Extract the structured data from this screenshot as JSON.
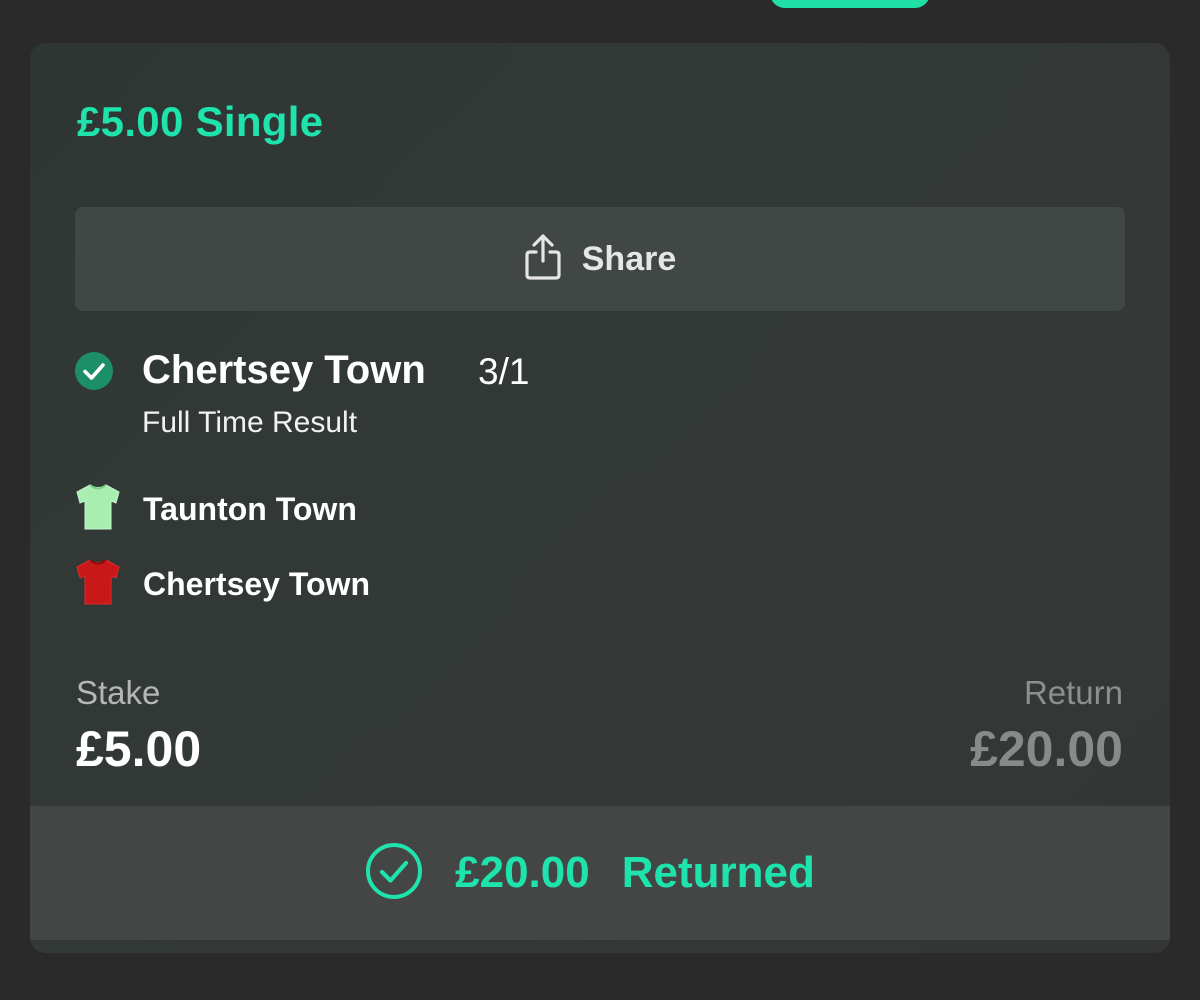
{
  "bet": {
    "title": "£5.00 Single",
    "share_label": "Share",
    "selection": {
      "name": "Chertsey Town",
      "odds": "3/1",
      "market": "Full Time Result",
      "status": "won"
    },
    "teams": [
      {
        "name": "Taunton Town",
        "shirt_color": "#a8eeb0"
      },
      {
        "name": "Chertsey Town",
        "shirt_color": "#c81818"
      }
    ],
    "stake_label": "Stake",
    "stake_value": "£5.00",
    "return_label": "Return",
    "return_value": "£20.00",
    "returned_amount": "£20.00",
    "returned_text": "Returned"
  },
  "colors": {
    "accent": "#1fe3ad",
    "card_background": "#333937",
    "page_background": "#2a2a2a"
  },
  "icons": {
    "share": "share-icon",
    "selection_status": "check-circle-filled-icon",
    "returned": "check-circle-outline-icon",
    "kit": "shirt-icon"
  }
}
